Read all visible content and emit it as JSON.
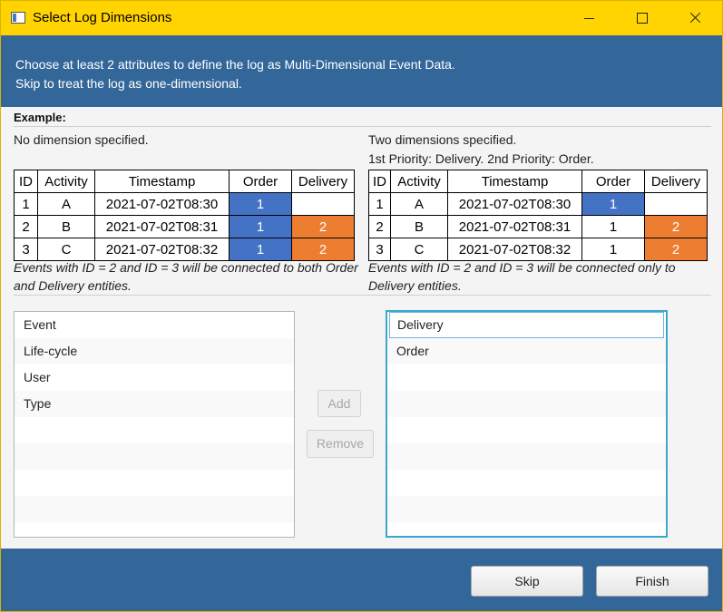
{
  "window": {
    "title": "Select Log Dimensions",
    "accent_color": "#ffd400",
    "header_color": "#336699"
  },
  "header": {
    "line1": "Choose at least 2 attributes to define the log as Multi-Dimensional Event Data.",
    "line2": "Skip to treat the log as one-dimensional."
  },
  "example": {
    "title": "Example:",
    "columns": [
      "ID",
      "Activity",
      "Timestamp",
      "Order",
      "Delivery"
    ],
    "left": {
      "label": "No dimension specified.",
      "rows": [
        [
          "1",
          "A",
          "2021-07-02T08:30",
          "1",
          ""
        ],
        [
          "2",
          "B",
          "2021-07-02T08:31",
          "1",
          "2"
        ],
        [
          "3",
          "C",
          "2021-07-02T08:32",
          "1",
          "2"
        ]
      ],
      "caption": "Events with ID = 2 and ID = 3 will be connected to both Order and Delivery entities."
    },
    "right": {
      "label": "Two dimensions specified.",
      "priority": "1st Priority: Delivery. 2nd Priority: Order.",
      "rows": [
        [
          "1",
          "A",
          "2021-07-02T08:30",
          "1",
          ""
        ],
        [
          "2",
          "B",
          "2021-07-02T08:31",
          "1",
          "2"
        ],
        [
          "3",
          "C",
          "2021-07-02T08:32",
          "1",
          "2"
        ]
      ],
      "caption": "Events with ID = 2 and ID = 3 will be connected only to Delivery entities."
    },
    "highlight_colors": {
      "order": "#4472c4",
      "delivery": "#ed7d31"
    }
  },
  "available_attributes": [
    "Event",
    "Life-cycle",
    "User",
    "Type"
  ],
  "selected_attributes": [
    "Delivery",
    "Order"
  ],
  "buttons": {
    "add": "Add",
    "remove": "Remove",
    "skip": "Skip",
    "finish": "Finish"
  }
}
